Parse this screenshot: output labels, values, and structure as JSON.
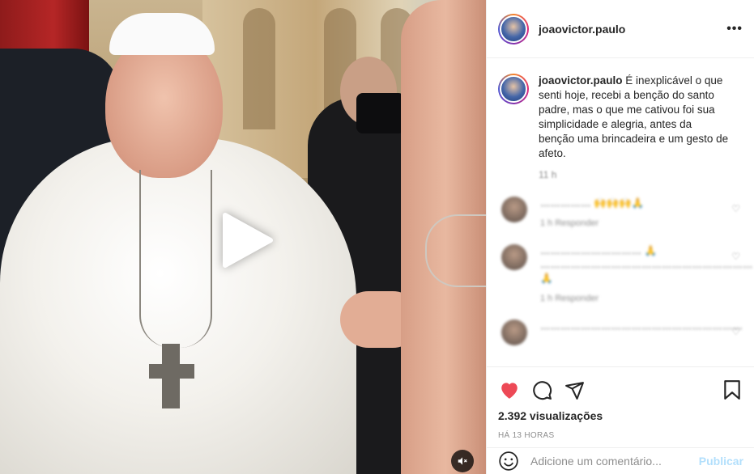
{
  "post": {
    "username": "joaovictor.paulo",
    "more_icon": "more-horizontal-icon"
  },
  "caption": {
    "username": "joaovictor.paulo",
    "text": "É inexplicável o que senti hoje, recebi a benção do santo padre, mas o que me cativou foi sua simplicidade e alegria, antes da benção uma brincadeira e um gesto de afeto.",
    "meta": "11 h"
  },
  "comments": [
    {
      "text": "…………… 🙌🙌🙌🙏",
      "meta": "1 h   Responder"
    },
    {
      "text": "………………………… 🙏 ……………………………………………………… 🙏",
      "meta": "1 h   Responder"
    },
    {
      "text": "……………………………………………………",
      "meta": ""
    }
  ],
  "stats": {
    "views": "2.392 visualizações",
    "time": "HÁ 13 HORAS"
  },
  "composer": {
    "placeholder": "Adicione um comentário...",
    "publish": "Publicar"
  },
  "colors": {
    "like_red": "#ed4956",
    "publish_disabled": "#b2dffc",
    "text_secondary": "#8e8e8e"
  }
}
